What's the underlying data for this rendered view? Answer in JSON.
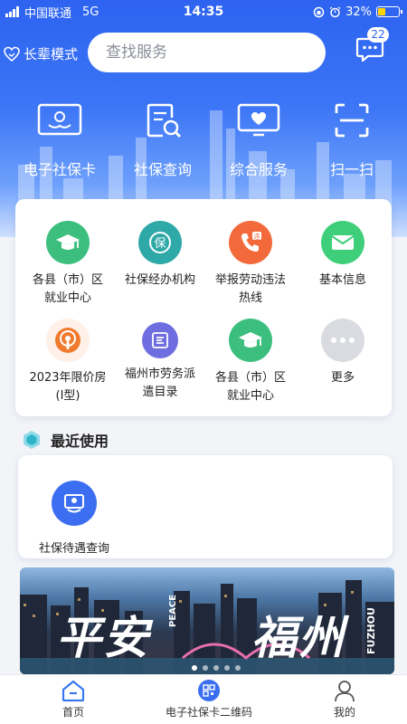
{
  "status_bar": {
    "carrier": "中国联通",
    "network": "5G",
    "time": "14:35",
    "battery": "32%"
  },
  "header": {
    "elder_mode": "长辈模式",
    "search_placeholder": "查找服务",
    "message_badge": "22",
    "quick_actions": [
      {
        "label": "电子社保卡",
        "icon": "social-card-icon"
      },
      {
        "label": "社保查询",
        "icon": "search-document-icon"
      },
      {
        "label": "综合服务",
        "icon": "heart-screen-icon"
      },
      {
        "label": "扫一扫",
        "icon": "scan-icon"
      }
    ]
  },
  "services": [
    {
      "line1": "各县（市）区",
      "line2": "就业中心",
      "icon": "graduation-cap-icon",
      "color": "#3cbf7e"
    },
    {
      "line1": "社保经办机构",
      "line2": "",
      "icon": "bao-badge-icon",
      "color": "#2fa8a8"
    },
    {
      "line1": "举报劳动违法",
      "line2": "热线",
      "icon": "phone-report-icon",
      "color": "#f26a3b"
    },
    {
      "line1": "基本信息",
      "line2": "",
      "icon": "mail-icon",
      "color": "#3fcf7a"
    },
    {
      "line1": "2023年限价房",
      "line2": "(I型)",
      "icon": "podcast-icon",
      "color": "#f07a2e"
    },
    {
      "line1": "福州市劳务派",
      "line2": "遣目录",
      "icon": "dispatch-icon",
      "color": "#6f6ee0"
    },
    {
      "line1": "各县（市）区",
      "line2": "就业中心",
      "icon": "graduation-cap-icon",
      "color": "#3cbf7e"
    },
    {
      "line1": "更多",
      "line2": "",
      "icon": "more-dots-icon",
      "color": "#d9dbe0"
    }
  ],
  "recent": {
    "title": "最近使用",
    "items": [
      {
        "label": "社保待遇查询",
        "icon": "benefit-query-icon",
        "color": "#3c6ef2"
      }
    ]
  },
  "banner": {
    "text_left": "平安",
    "text_right": "福州",
    "en_left": "PEACE",
    "en_right": "FUZHOU"
  },
  "tab_bar": {
    "tabs": [
      {
        "label": "首页",
        "icon": "home-icon"
      },
      {
        "label": "电子社保卡二维码",
        "icon": "qr-code-icon"
      },
      {
        "label": "我的",
        "icon": "profile-icon"
      }
    ]
  }
}
